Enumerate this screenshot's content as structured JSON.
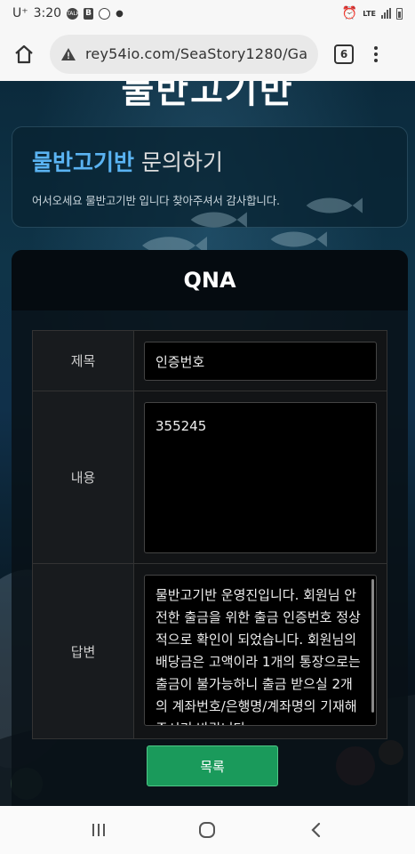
{
  "status_bar": {
    "carrier": "U⁺",
    "time": "3:20",
    "notif_badge": "TALK",
    "notif_b": "B",
    "network": "LTE"
  },
  "browser": {
    "url": "rey54io.com/SeaStory1280/Ga",
    "tab_count": "6"
  },
  "page": {
    "heading": "물반고기반",
    "intro": {
      "title_accent": "물반고기반",
      "title_rest": " 문의하기",
      "description": "어서오세요 물반고기반 입니다 찾아주셔서 감사합니다."
    },
    "qna": {
      "header": "QNA",
      "fields": {
        "subject_label": "제목",
        "subject_value": "인증번호",
        "content_label": "내용",
        "content_value": "355245",
        "answer_label": "답변",
        "answer_value": "물반고기반 운영진입니다. 회원님 안전한 출금을 위한 출금 인증번호 정상적으로 확인이 되었습니다. 회원님의 배당금은 고액이라 1개의 통장으로는 출금이 불가능하니 출금 받으실 2개의 계좌번호/은행명/계좌명의 기재해주시기 바랍니다."
      }
    },
    "list_button": "목록"
  },
  "colors": {
    "accent": "#5ab3f2",
    "button": "#1a9a5b"
  }
}
